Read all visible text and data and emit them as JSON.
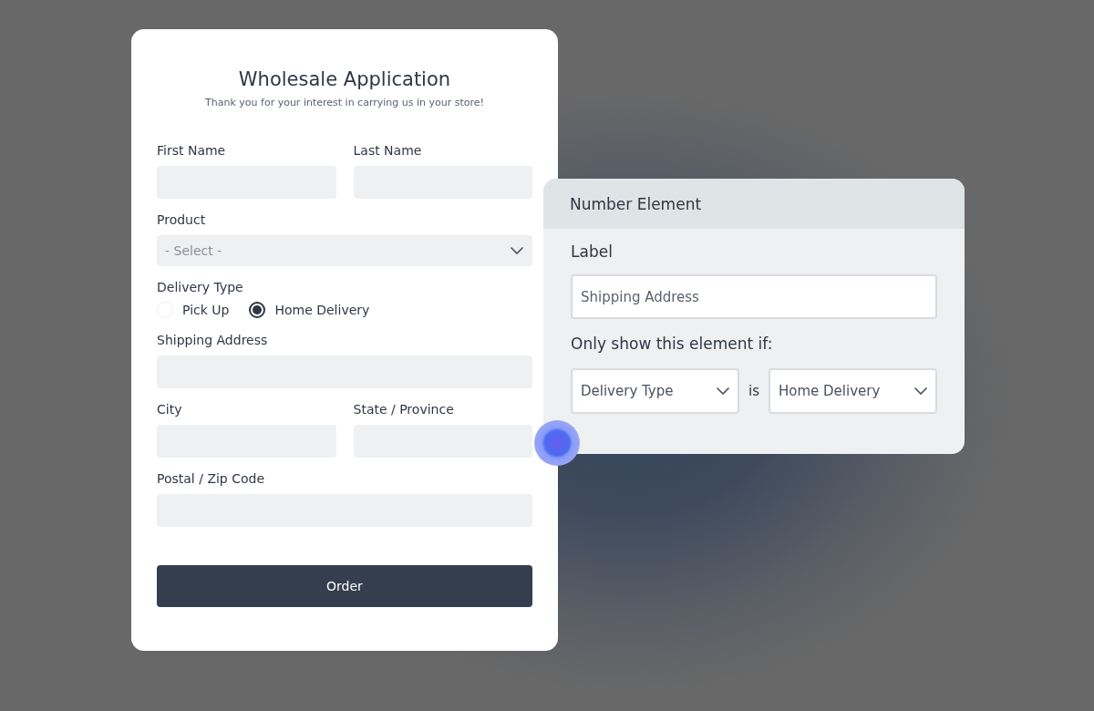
{
  "form": {
    "title": "Wholesale Application",
    "subtitle": "Thank you for your interest in carrying us in your store!",
    "rows": [
      [
        {
          "kind": "text",
          "label": "First Name"
        },
        {
          "kind": "text",
          "label": "Last Name"
        }
      ],
      [
        {
          "kind": "select",
          "label": "Product",
          "placeholder": "- Select -"
        }
      ],
      [
        {
          "kind": "radio",
          "label": "Delivery Type",
          "options": [
            {
              "label": "Pick Up",
              "selected": false
            },
            {
              "label": "Home Delivery",
              "selected": true
            }
          ]
        }
      ],
      [
        {
          "kind": "text",
          "label": "Shipping Address"
        }
      ],
      [
        {
          "kind": "text",
          "label": "City"
        },
        {
          "kind": "text",
          "label": "State / Province"
        }
      ],
      [
        {
          "kind": "text",
          "label": "Postal / Zip Code"
        }
      ]
    ],
    "submit": "Order"
  },
  "panel": {
    "title": "Number Element",
    "label_heading": "Label",
    "label_value": "Shipping Address",
    "condition_heading": "Only show this element if:",
    "condition": {
      "field": "Delivery Type",
      "operator": "is",
      "value": "Home Delivery"
    }
  }
}
